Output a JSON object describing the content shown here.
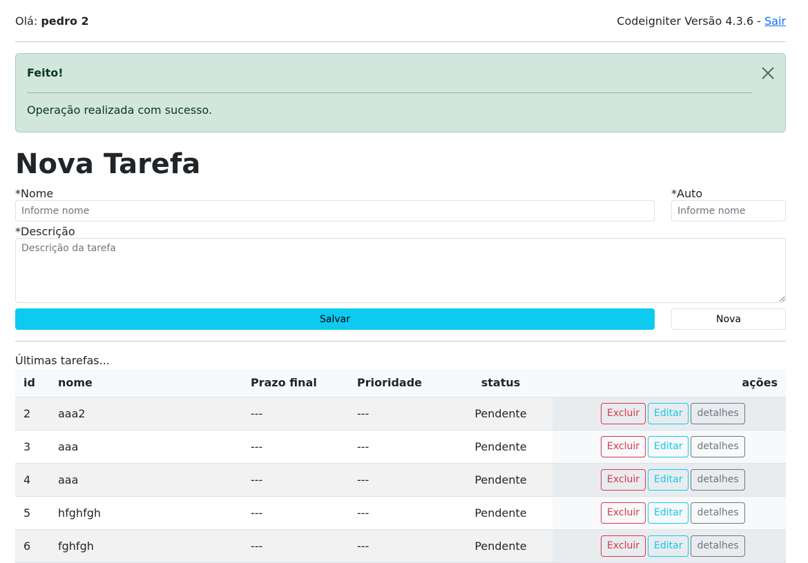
{
  "header": {
    "greeting_prefix": "Olá:",
    "user_name": "pedro 2",
    "version_text": "Codeigniter Versão 4.3.6 -",
    "logout_label": "Sair"
  },
  "alert": {
    "title": "Feito!",
    "message": "Operação realizada com sucesso.",
    "color": "#d1e7dd"
  },
  "form": {
    "title": "Nova Tarefa",
    "nome_label": "*Nome",
    "nome_placeholder": "Informe nome",
    "auto_label": "*Auto",
    "auto_placeholder": "Informe nome",
    "descricao_label": "*Descrição",
    "descricao_placeholder": "Descrição da tarefa",
    "save_label": "Salvar",
    "new_label": "Nova",
    "save_color": "#0dcaf0"
  },
  "list": {
    "caption": "Últimas tarefas...",
    "columns": [
      "id",
      "nome",
      "Prazo final",
      "Prioridade",
      "status",
      "ações"
    ],
    "delete_label": "Excluir",
    "edit_label": "Editar",
    "details_label": "detalhes",
    "rows": [
      {
        "id": "2",
        "nome": "aaa2",
        "prazo": "---",
        "prioridade": "---",
        "status": "Pendente"
      },
      {
        "id": "3",
        "nome": "aaa",
        "prazo": "---",
        "prioridade": "---",
        "status": "Pendente"
      },
      {
        "id": "4",
        "nome": "aaa",
        "prazo": "---",
        "prioridade": "---",
        "status": "Pendente"
      },
      {
        "id": "5",
        "nome": "hfghfgh",
        "prazo": "---",
        "prioridade": "---",
        "status": "Pendente"
      },
      {
        "id": "6",
        "nome": "fghfgh",
        "prazo": "---",
        "prioridade": "---",
        "status": "Pendente"
      }
    ]
  }
}
